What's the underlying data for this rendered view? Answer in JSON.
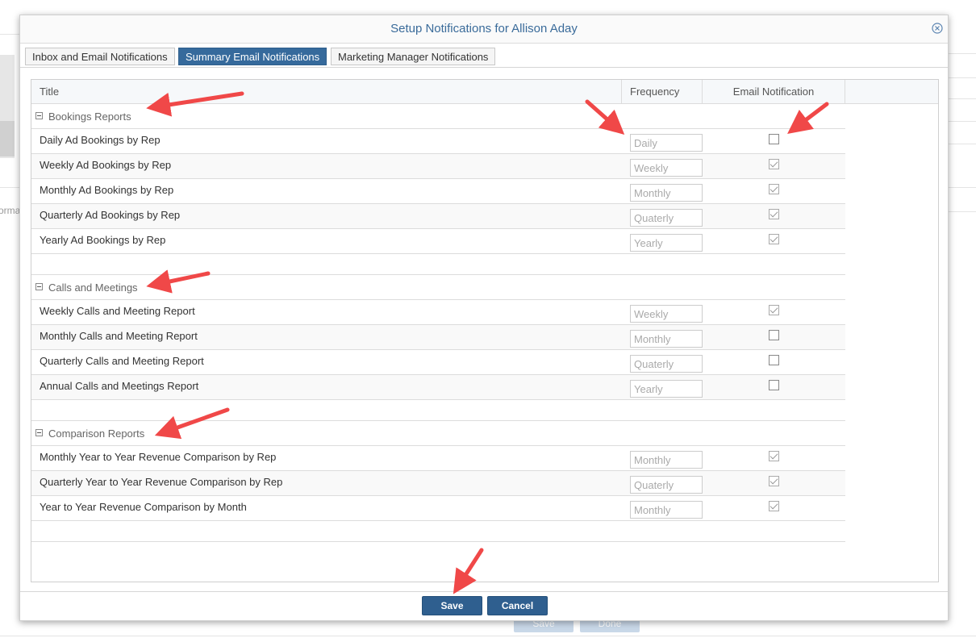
{
  "background": {
    "truncated_text": "orma",
    "buttons": [
      "Save",
      "Done"
    ]
  },
  "modal": {
    "title": "Setup Notifications for Allison Aday",
    "close_icon": "close-circle-icon"
  },
  "tabs": [
    {
      "label": "Inbox and Email Notifications",
      "active": false
    },
    {
      "label": "Summary Email Notifications",
      "active": true
    },
    {
      "label": "Marketing Manager Notifications",
      "active": false
    }
  ],
  "grid": {
    "columns": [
      "Title",
      "Frequency",
      "Email Notification"
    ],
    "groups": [
      {
        "name": "Bookings Reports",
        "rows": [
          {
            "title": "Daily Ad Bookings by Rep",
            "frequency": "Daily",
            "email": false
          },
          {
            "title": "Weekly Ad Bookings by Rep",
            "frequency": "Weekly",
            "email": true
          },
          {
            "title": "Monthly Ad Bookings by Rep",
            "frequency": "Monthly",
            "email": true
          },
          {
            "title": "Quarterly Ad Bookings by Rep",
            "frequency": "Quaterly",
            "email": true
          },
          {
            "title": "Yearly Ad Bookings by Rep",
            "frequency": "Yearly",
            "email": true
          }
        ]
      },
      {
        "name": "Calls and Meetings",
        "rows": [
          {
            "title": "Weekly Calls and Meeting Report",
            "frequency": "Weekly",
            "email": true
          },
          {
            "title": "Monthly Calls and Meeting Report",
            "frequency": "Monthly",
            "email": false
          },
          {
            "title": "Quarterly Calls and Meeting Report",
            "frequency": "Quaterly",
            "email": false
          },
          {
            "title": "Annual Calls and Meetings Report",
            "frequency": "Yearly",
            "email": false
          }
        ]
      },
      {
        "name": "Comparison Reports",
        "rows": [
          {
            "title": "Monthly Year to Year Revenue Comparison by Rep",
            "frequency": "Monthly",
            "email": true
          },
          {
            "title": "Quarterly Year to Year Revenue Comparison by Rep",
            "frequency": "Quaterly",
            "email": true
          },
          {
            "title": "Year to Year Revenue Comparison by Month",
            "frequency": "Monthly",
            "email": true
          }
        ]
      }
    ]
  },
  "footer": {
    "save_label": "Save",
    "cancel_label": "Cancel"
  },
  "colors": {
    "primary": "#2f5f8f",
    "title_text": "#3a6b9a",
    "annotation_arrow": "#f04848"
  }
}
